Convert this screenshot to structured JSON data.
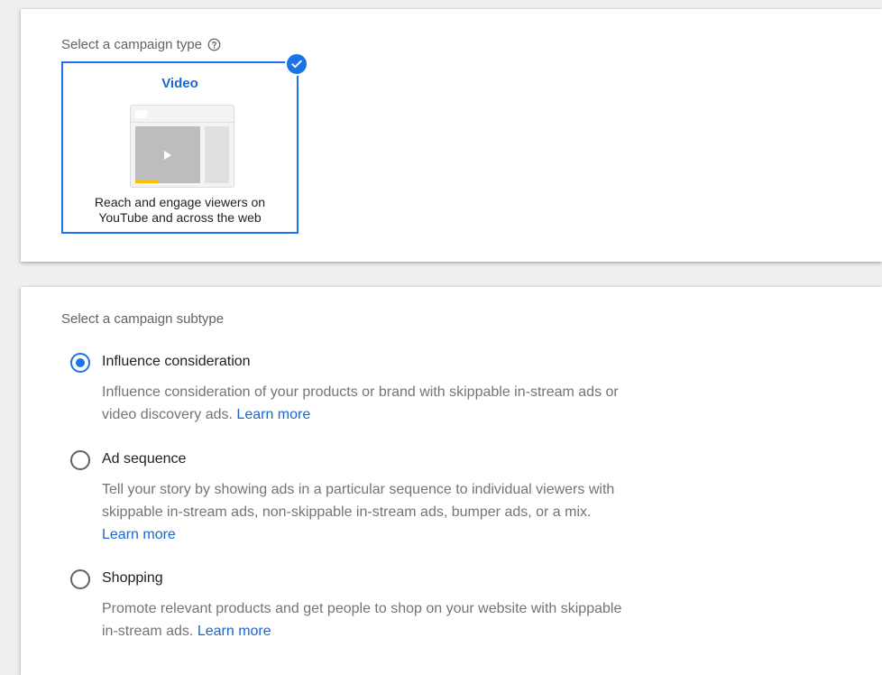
{
  "campaign_type": {
    "title": "Select a campaign type",
    "help_icon": "help-circle-icon",
    "selected_tile": {
      "title": "Video",
      "description_line1": "Reach and engage viewers on",
      "description_line2": "YouTube and across the web",
      "selected": true,
      "check_icon": "check-circle-icon"
    }
  },
  "campaign_subtype": {
    "title": "Select a campaign subtype",
    "options": [
      {
        "label": "Influence consideration",
        "description": "Influence consideration of your products or brand with skippable in-stream ads or video discovery ads.",
        "learn_more": "Learn more",
        "selected": true
      },
      {
        "label": "Ad sequence",
        "description": "Tell your story by showing ads in a particular sequence to individual viewers with skippable in-stream ads, non-skippable in-stream ads, bumper ads, or a mix.",
        "learn_more": "Learn more",
        "selected": false
      },
      {
        "label": "Shopping",
        "description": "Promote relevant products and get people to shop on your website with skippable in-stream ads.",
        "learn_more": "Learn more",
        "selected": false
      }
    ]
  },
  "colors": {
    "accent": "#1a73e8",
    "link": "#1967d2",
    "muted_text": "#70757a",
    "progress": "#fbbc04"
  }
}
